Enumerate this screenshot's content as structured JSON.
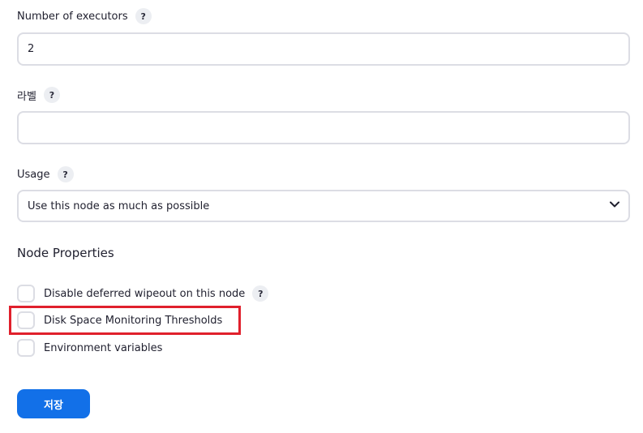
{
  "executors": {
    "label": "Number of executors",
    "help": "?",
    "value": "2"
  },
  "labels": {
    "label": "라벨",
    "help": "?",
    "value": ""
  },
  "usage": {
    "label": "Usage",
    "help": "?",
    "selected": "Use this node as much as possible"
  },
  "node_properties": {
    "title": "Node Properties",
    "items": [
      {
        "label": "Disable deferred wipeout on this node",
        "help": "?",
        "checked": false
      },
      {
        "label": "Disk Space Monitoring Thresholds",
        "checked": false,
        "highlighted": true
      },
      {
        "label": "Environment variables",
        "checked": false
      }
    ]
  },
  "save_button": {
    "label": "저장",
    "color": "#1270e8"
  },
  "highlight_color": "#e0202c"
}
